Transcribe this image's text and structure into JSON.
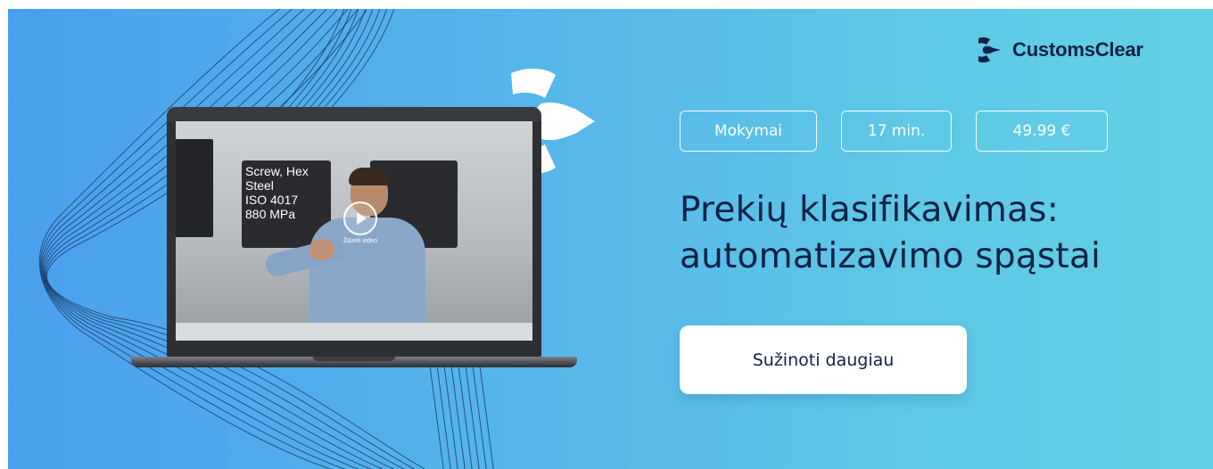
{
  "brand": {
    "name": "CustomsClear",
    "icon": "customsclear-arrow-logo-icon",
    "color_dark": "#0f2146"
  },
  "banner": {
    "gradient_start": "#4a9fec",
    "gradient_end": "#62d0e4"
  },
  "video": {
    "play_icon": "play-icon",
    "play_label": "Žiūrėti video",
    "sign_lines": [
      "Screw, Hex",
      "Steel",
      "ISO 4017",
      "880 MPa"
    ]
  },
  "tags": {
    "category": "Mokymai",
    "duration": "17 min.",
    "price": "49.99 €"
  },
  "headline": {
    "line1": "Prekių klasifikavimas:",
    "line2": "automatizavimo spąstai"
  },
  "cta": {
    "label": "Sužinoti daugiau"
  }
}
